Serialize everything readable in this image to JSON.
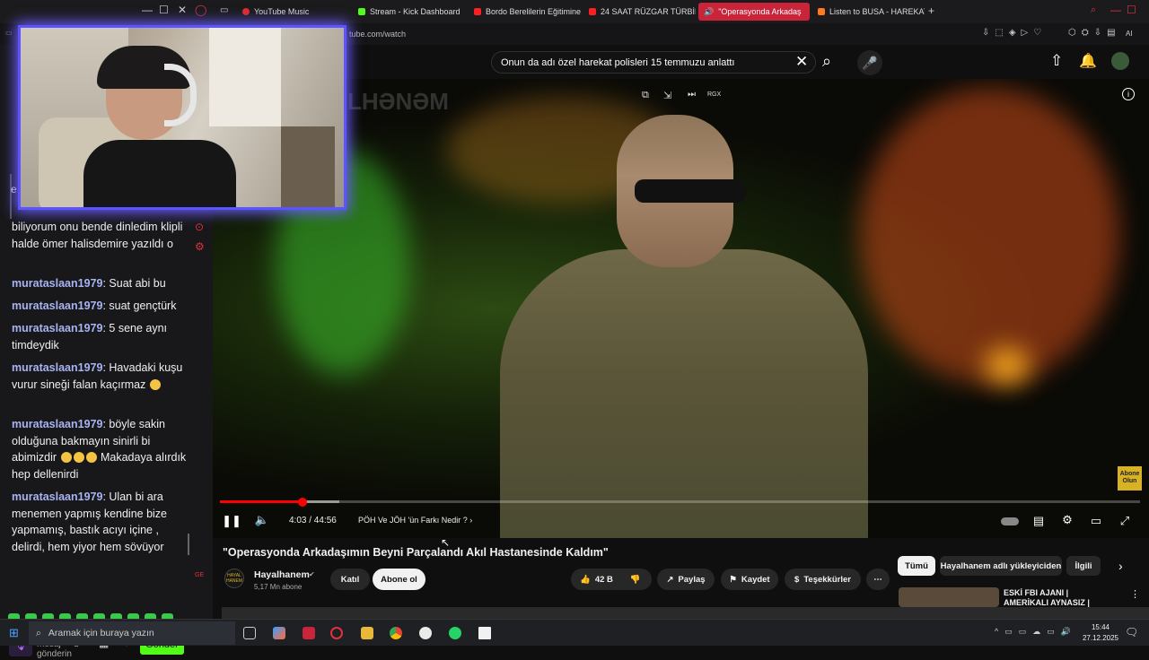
{
  "tabs": [
    {
      "label": "YouTube Music",
      "color": "#e02a2a"
    },
    {
      "label": "Stream - Kick Dashboard",
      "color": "#53fc18"
    },
    {
      "label": "Bordo Berelilerin Eğitimine",
      "color": "#ff2020"
    },
    {
      "label": "24 SAAT RÜZGAR TÜRBİNİ",
      "color": "#ff2020"
    },
    {
      "label": "\"Operasyonda Arkadaş",
      "color": "#ffffff"
    },
    {
      "label": "Listen to BUSA - HAREKAT",
      "color": "#ff7a1a"
    }
  ],
  "address": {
    "url": "tube.com/watch"
  },
  "chat": {
    "partial_top": "e",
    "messages": [
      {
        "text": "biliyorum onu bende dinledim klipli halde ömer halisdemire yazıldı o"
      },
      {
        "user": "murataslaan1979",
        "text": ": Suat abi bu"
      },
      {
        "user": "murataslaan1979",
        "text": ": suat gençtürk"
      },
      {
        "user": "murataslaan1979",
        "text": ": 5 sene aynı timdeydik"
      },
      {
        "user": "murataslaan1979",
        "text": ": Havadaki kuşu vurur sineği falan kaçırmaz"
      },
      {
        "user": "murataslaan1979",
        "text": ": böyle sakin olduğuna bakmayın sinirli bi abimizdir"
      },
      {
        "text2": "Makadaya alırdık hep dellenirdi"
      },
      {
        "user": "murataslaan1979",
        "text": ": Ulan bi ara menemen yapmış kendine bize yapmamış, bastık acıyı içine , delirdi, hem yiyor hem sövüyor"
      }
    ],
    "input_placeholder": "Bir mesaj gönderin",
    "send_label": "Gönder"
  },
  "youtube": {
    "search_value": "Onun da adı özel harekat polisleri 15 temmuzu anlattı",
    "player": {
      "time": "4:03 / 44:56",
      "chapter": "PÖH Ve JÖH 'ün Farkı Nedir ?",
      "progress": 0.09,
      "loaded": 0.13,
      "watermark": "LHƏNƏM",
      "overlay_label": "RGX",
      "abone_badge": "Abone Olun"
    },
    "title": "\"Operasyonda Arkadaşımın Beyni Parçalandı Akıl Hastanesinde Kaldım\"",
    "channel": {
      "name": "Hayalhanem",
      "subs": "5,17 Mn abone",
      "logo_text": "HAYAL HANEM"
    },
    "buttons": {
      "join": "Katıl",
      "subscribe": "Abone ol",
      "likes": "42 B",
      "share": "Paylaş",
      "save": "Kaydet",
      "thanks": "Teşekkürler"
    },
    "chips": [
      "Tümü",
      "Hayalhanem adlı yükleyiciden",
      "İlgili"
    ],
    "rec": {
      "title": "ESKİ FBI AJANI | AMERİKALI AYNASIZ | SARSILMAZ"
    }
  },
  "taskbar": {
    "search": "Aramak için buraya yazın",
    "time": "15:44",
    "date": "27.12.2025"
  }
}
